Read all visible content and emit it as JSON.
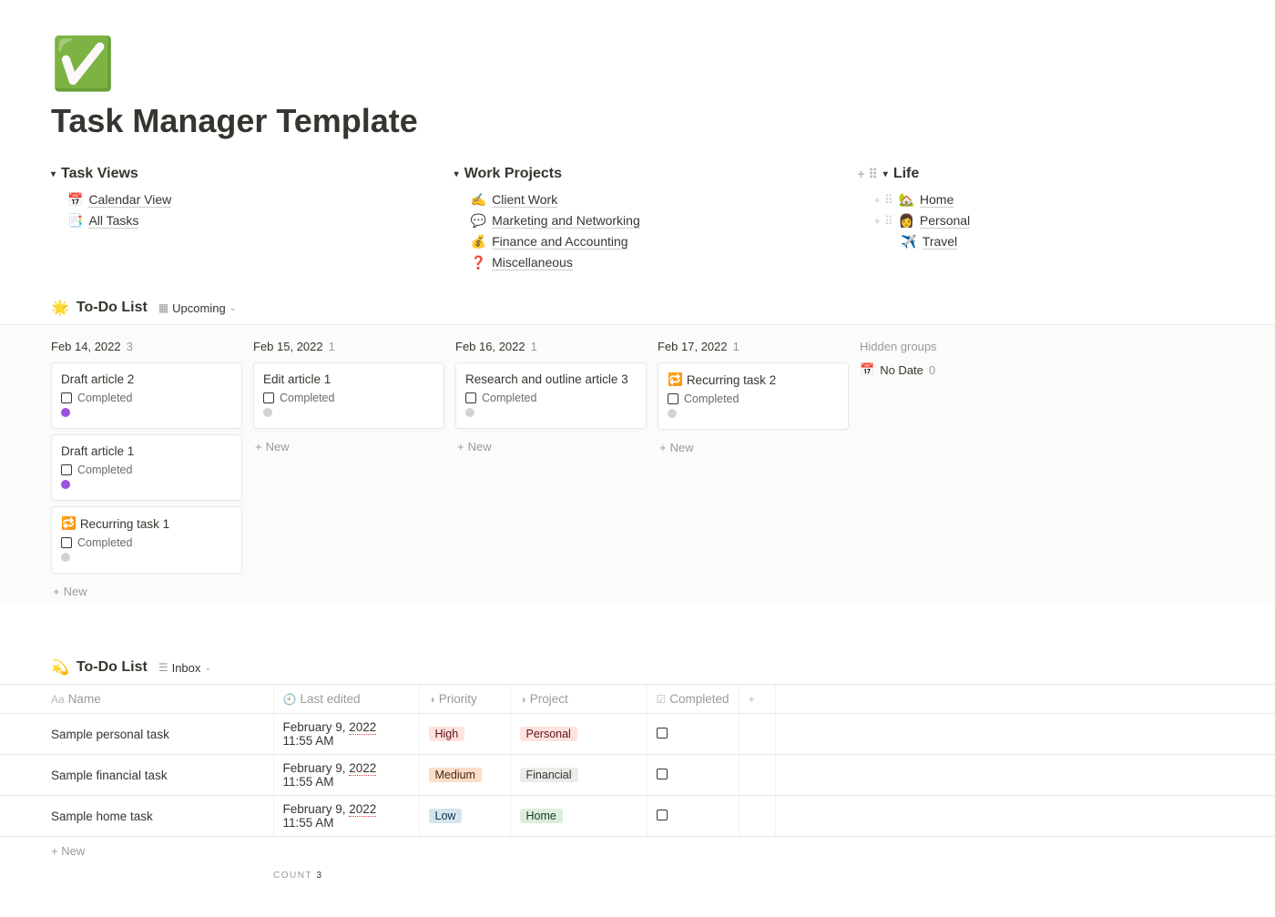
{
  "page": {
    "icon": "✅",
    "title": "Task Manager Template"
  },
  "sections": {
    "task_views": {
      "header": "Task Views",
      "items": [
        {
          "emoji": "📅",
          "label": "Calendar View"
        },
        {
          "emoji": "📑",
          "label": "All Tasks"
        }
      ]
    },
    "work_projects": {
      "header": "Work Projects",
      "items": [
        {
          "emoji": "✍️",
          "label": "Client Work"
        },
        {
          "emoji": "💬",
          "label": "Marketing and Networking"
        },
        {
          "emoji": "💰",
          "label": "Finance and Accounting"
        },
        {
          "emoji": "❓",
          "label": "Miscellaneous"
        }
      ]
    },
    "life": {
      "header": "Life",
      "items": [
        {
          "emoji": "🏡",
          "label": "Home",
          "show_extras": true
        },
        {
          "emoji": "👩",
          "label": "Personal",
          "show_extras": true
        },
        {
          "emoji": "✈️",
          "label": "Travel",
          "show_extras": false
        }
      ]
    }
  },
  "board_db": {
    "icon": "🌟",
    "title": "To-Do List",
    "view_name": "Upcoming",
    "columns": [
      {
        "date": "Feb 14, 2022",
        "count": "3",
        "cards": [
          {
            "title": "Draft article 2",
            "completed_label": "Completed",
            "dot": "purple"
          },
          {
            "title": "Draft article 1",
            "completed_label": "Completed",
            "dot": "purple"
          },
          {
            "icon": "🔁",
            "title": "Recurring task 1",
            "completed_label": "Completed",
            "dot": "grey"
          }
        ]
      },
      {
        "date": "Feb 15, 2022",
        "count": "1",
        "cards": [
          {
            "title": "Edit article 1",
            "completed_label": "Completed",
            "dot": "grey"
          }
        ]
      },
      {
        "date": "Feb 16, 2022",
        "count": "1",
        "cards": [
          {
            "title": "Research and outline article 3",
            "completed_label": "Completed",
            "dot": "grey"
          }
        ]
      },
      {
        "date": "Feb 17, 2022",
        "count": "1",
        "cards": [
          {
            "icon": "🔁",
            "title": "Recurring task 2",
            "completed_label": "Completed",
            "dot": "grey"
          }
        ]
      }
    ],
    "hidden_groups_label": "Hidden groups",
    "hidden_groups": [
      {
        "icon": "📅",
        "label": "No Date",
        "count": "0"
      }
    ],
    "new_label": "New"
  },
  "table_db": {
    "icon": "💫",
    "title": "To-Do List",
    "view_name": "Inbox",
    "columns": {
      "name": "Name",
      "last_edited": "Last edited",
      "priority": "Priority",
      "project": "Project",
      "completed": "Completed"
    },
    "rows": [
      {
        "name": "Sample personal task",
        "edited_prefix": "February 9, ",
        "edited_year": "2022",
        "edited_suffix": " 11:55 AM",
        "priority": "High",
        "priority_class": "tag-high",
        "project": "Personal",
        "project_class": "tag-personal"
      },
      {
        "name": "Sample financial task",
        "edited_prefix": "February 9, ",
        "edited_year": "2022",
        "edited_suffix": " 11:55 AM",
        "priority": "Medium",
        "priority_class": "tag-medium",
        "project": "Financial",
        "project_class": "tag-financial"
      },
      {
        "name": "Sample home task",
        "edited_prefix": "February 9, ",
        "edited_year": "2022",
        "edited_suffix": " 11:55 AM",
        "priority": "Low",
        "priority_class": "tag-low",
        "project": "Home",
        "project_class": "tag-home"
      }
    ],
    "new_label": "New",
    "count_label": "COUNT",
    "count_value": "3"
  }
}
